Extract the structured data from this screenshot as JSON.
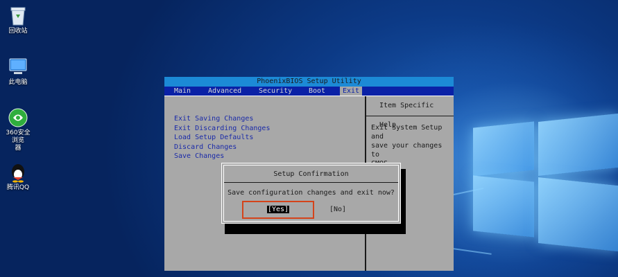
{
  "desktop": {
    "icons": [
      {
        "label": "回收站",
        "icon": "recycle-bin-icon"
      },
      {
        "label": "此电脑",
        "icon": "computer-icon"
      },
      {
        "label": "360安全浏览\n器",
        "icon": "browser-360-icon"
      },
      {
        "label": "腾讯QQ",
        "icon": "qq-penguin-icon"
      }
    ]
  },
  "bios": {
    "title": "PhoenixBIOS Setup Utility",
    "menu": [
      "Main",
      "Advanced",
      "Security",
      "Boot",
      "Exit"
    ],
    "active_menu": "Exit",
    "options": [
      "Exit Saving Changes",
      "Exit Discarding Changes",
      "Load Setup Defaults",
      "Discard Changes",
      "Save Changes"
    ],
    "help_header": "Item Specific Help",
    "help_lines": [
      "Exit System Setup and",
      "save your changes to",
      "CMOS."
    ],
    "colors": {
      "title_bar": "#1c8ad6",
      "menu_bar": "#0a21a6",
      "panel": "#a8a8a8",
      "option_text": "#1a2aa8",
      "focus_border": "#d4431a"
    }
  },
  "dialog": {
    "title": "Setup Confirmation",
    "message": "Save configuration changes and exit now?",
    "yes_label": "[Yes]",
    "no_label": "[No]"
  }
}
